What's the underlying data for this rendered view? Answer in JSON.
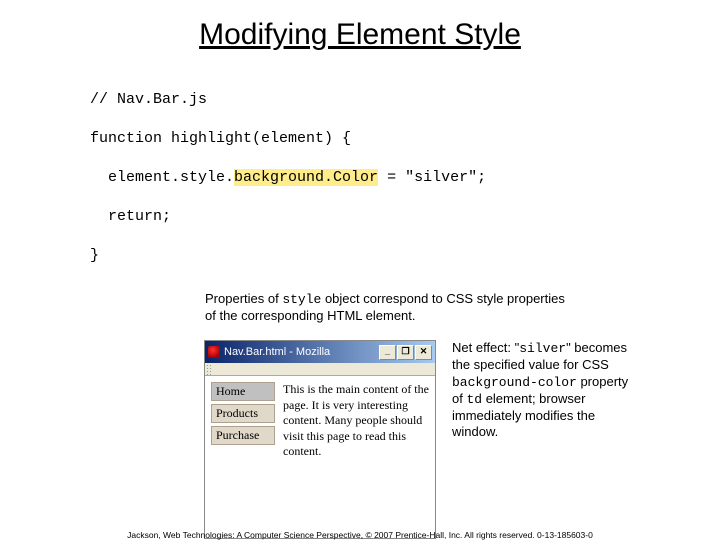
{
  "title": "Modifying Element Style",
  "code": {
    "l1": "// Nav.Bar.js",
    "l2": "function highlight(element) {",
    "l3_a": "  element.style.",
    "l3_b": "background.Color",
    "l3_c": " = \"silver\";",
    "l4": "  return;",
    "l5": "}"
  },
  "ann1": {
    "a": "Properties of ",
    "b": "style",
    "c": " object correspond to CSS style properties of the corresponding HTML element."
  },
  "browser": {
    "title": "Nav.Bar.html - Mozilla",
    "min": "_",
    "max": "❐",
    "close": "✕",
    "nav0": "Home",
    "nav1": "Products",
    "nav2": "Purchase",
    "main": "This is the main content of the page. It is very interesting content. Many people should visit this page to read this content."
  },
  "side": {
    "a": "Net effect: \"",
    "b": "silver",
    "c": "\" becomes the specified value for CSS ",
    "d": "background-color",
    "e": " property of ",
    "f": "td",
    "g": " element; browser immediately modifies the window."
  },
  "footer": "Jackson, Web Technologies: A Computer Science Perspective, © 2007 Prentice-Hall, Inc. All rights reserved. 0-13-185603-0"
}
